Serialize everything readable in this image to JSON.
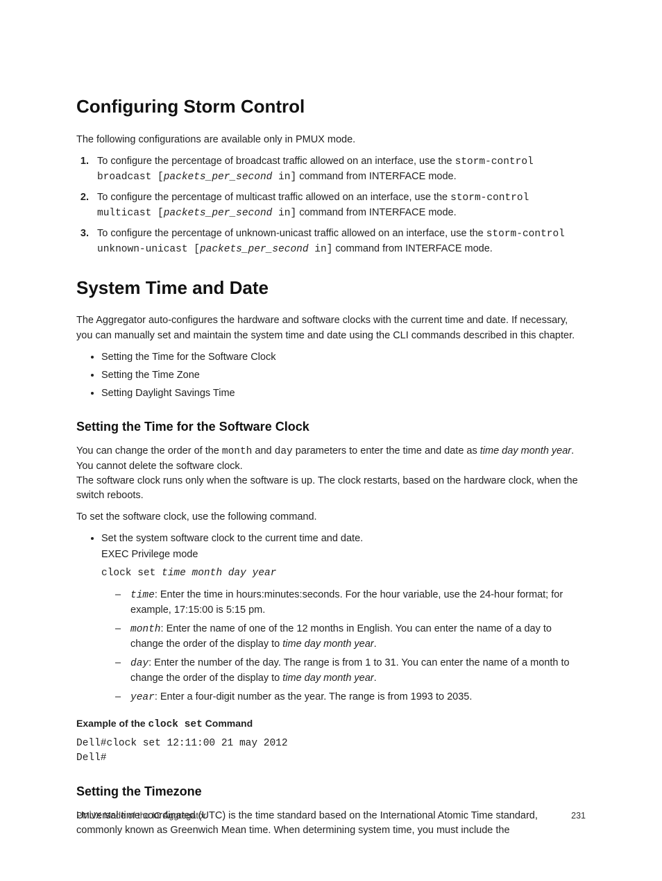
{
  "h1_1": "Configuring Storm Control",
  "p1": "The following configurations are available only in PMUX mode.",
  "ol1": {
    "i1_a": "To configure the percentage of broadcast traffic allowed on an interface, use the ",
    "i1_c1": "storm-control broadcast [",
    "i1_em": "packets_per_second",
    "i1_c2": " in]",
    "i1_b": " command from INTERFACE mode.",
    "i2_a": "To configure the percentage of multicast traffic allowed on an interface, use the ",
    "i2_c1": "storm-control multicast [",
    "i2_em": "packets_per_second",
    "i2_c2": " in]",
    "i2_b": " command from INTERFACE mode.",
    "i3_a": "To configure the percentage of unknown-unicast traffic allowed on an interface, use the ",
    "i3_c1": "storm-control unknown-unicast [",
    "i3_em": "packets_per_second",
    "i3_c2": " in]",
    "i3_b": " command from INTERFACE mode."
  },
  "h1_2": "System Time and Date",
  "p2": "The Aggregator auto-configures the hardware and software clocks with the current time and date. If necessary, you can manually set and maintain the system time and date using the CLI commands described in this chapter.",
  "ul1": {
    "i1": "Setting the Time for the Software Clock",
    "i2": "Setting the Time Zone",
    "i3": "Setting Daylight Savings Time"
  },
  "h2_1": "Setting the Time for the Software Clock",
  "p3a": "You can change the order of the ",
  "p3_c1": "month",
  "p3b": " and ",
  "p3_c2": "day",
  "p3c": " parameters to enter the time and date as ",
  "p3_em": "time day month year",
  "p3d": ". You cannot delete the software clock.",
  "p3e": "The software clock runs only when the software is up. The clock restarts, based on the hardware clock, when the switch reboots.",
  "p4": "To set the software clock, use the following command.",
  "ul2": {
    "i1": "Set the system software clock to the current time and date.",
    "i1_mode": "EXEC Privilege mode",
    "i1_cmd_a": "clock set ",
    "i1_cmd_em": "time month day year",
    "time_lbl": "time",
    "time_txt": ": Enter the time in hours:minutes:seconds. For the hour variable, use the 24-hour format; for example, 17:15:00 is 5:15 pm.",
    "month_lbl": "month",
    "month_txt_a": ": Enter the name of one of the 12 months in English. You can enter the name of a day to change the order of the display to ",
    "month_em": "time day month year",
    "month_txt_b": ".",
    "day_lbl": "day",
    "day_txt_a": ": Enter the number of the day. The range is from 1 to 31. You can enter the name of a month to change the order of the display to ",
    "day_em": "time day month year",
    "day_txt_b": ".",
    "year_lbl": "year",
    "year_txt": ": Enter a four-digit number as the year. The range is from 1993 to 2035."
  },
  "ex_head_a": "Example of the ",
  "ex_head_code": "clock set",
  "ex_head_b": " Command",
  "ex_block": "Dell#clock set 12:11:00 21 may 2012\nDell#",
  "h2_2": "Setting the Timezone",
  "p5": "Universal time coordinated (UTC) is the time standard based on the International Atomic Time standard, commonly known as Greenwich Mean time. When determining system time, you must include the",
  "footer_left": "PMUX Mode of the IO Aggregator",
  "footer_right": "231"
}
